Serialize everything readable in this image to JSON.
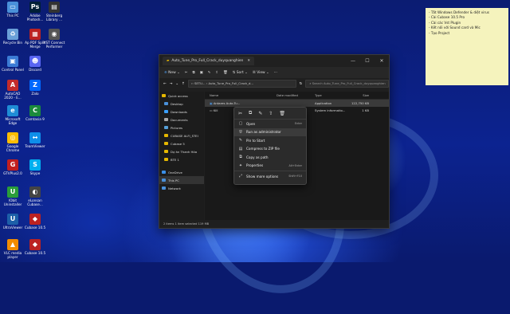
{
  "note": {
    "lines": [
      "- Tắt Windows Defender & diệt virus",
      "- Cài Cubase 10.5 Pro",
      "- Cài các Vst Plugin",
      "- Kết nối với Sound card và Mic",
      "- Tạo Project"
    ]
  },
  "desktop": {
    "icons": [
      {
        "label": "This PC",
        "color": "#4a90d9",
        "glyph": "▭"
      },
      {
        "label": "Adobe Photosh...",
        "color": "#001e36",
        "glyph": "Ps"
      },
      {
        "label": "Steinberg Library ...",
        "color": "#333",
        "glyph": "▤"
      },
      {
        "label": "Recycle Bin",
        "color": "#6aa0d8",
        "glyph": "♻"
      },
      {
        "label": "Ap PDF Split Merge",
        "color": "#b22",
        "glyph": "▦"
      },
      {
        "label": "VST Connect Performer",
        "color": "#555",
        "glyph": "◉"
      },
      {
        "label": "Control Panel",
        "color": "#3b7bd5",
        "glyph": "▣"
      },
      {
        "label": "Discord",
        "color": "#5865f2",
        "glyph": "☻"
      },
      {
        "label": "AutoCAD 2020 - E...",
        "color": "#c42b2b",
        "glyph": "A"
      },
      {
        "label": "Zalo",
        "color": "#0068ff",
        "glyph": "Z"
      },
      {
        "label": "Microsoft Edge",
        "color": "#1f8dd6",
        "glyph": "e"
      },
      {
        "label": "Camtasia 9",
        "color": "#1b8a3c",
        "glyph": "C"
      },
      {
        "label": "Google Chrome",
        "color": "#fbbc05",
        "glyph": "◎"
      },
      {
        "label": "TeamViewer",
        "color": "#0e8ee9",
        "glyph": "↔"
      },
      {
        "label": "GTVPlus2.0",
        "color": "#c21f1f",
        "glyph": "G"
      },
      {
        "label": "Skype",
        "color": "#00aff0",
        "glyph": "S"
      },
      {
        "label": "IObit Uninstaller",
        "color": "#2a9d3a",
        "glyph": "U"
      },
      {
        "label": "eLonsan Cubase...",
        "color": "#444",
        "glyph": "◐"
      },
      {
        "label": "UltraViewer",
        "color": "#1d5fa8",
        "glyph": "U"
      },
      {
        "label": "Cubase 10.5",
        "color": "#b22",
        "glyph": "◆"
      },
      {
        "label": "VLC media player",
        "color": "#f28c00",
        "glyph": "▲"
      },
      {
        "label": "Cubase 10.5",
        "color": "#b22",
        "glyph": "◆"
      }
    ]
  },
  "explorer": {
    "tab_title": "Auto_Tune_Pro_Full_Crack_duyquanghien",
    "window_controls": {
      "minimize": "—",
      "maximize": "☐",
      "close": "✕"
    },
    "toolbar": {
      "new_label": "New",
      "sort_label": "Sort",
      "view_label": "View",
      "more": "···"
    },
    "address": {
      "path": "‹‹  SETU...  ›  Auto_Tune_Pro_Full_Crack_d...",
      "search_placeholder": "Search Auto_Tune_Pro_Full_Crack_duyquanghien"
    },
    "sidebar": {
      "items": [
        {
          "label": "Quick access",
          "color": "#e6b800"
        },
        {
          "label": "Desktop",
          "color": "#4a90d9"
        },
        {
          "label": "Downloads",
          "color": "#3aa0ff"
        },
        {
          "label": "Documents",
          "color": "#aaaaaa"
        },
        {
          "label": "Pictures",
          "color": "#56a0d8"
        },
        {
          "label": "CUBASE ALFI_STEI",
          "color": "#e6b800"
        },
        {
          "label": "Cubase 5",
          "color": "#e6b800"
        },
        {
          "label": "Dự án Thanh Hóa",
          "color": "#e6b800"
        },
        {
          "label": "BTE 1",
          "color": "#e6b800"
        },
        {
          "label": "OneDrive",
          "color": "#3a8ee6"
        },
        {
          "label": "This PC",
          "color": "#4a90d9"
        },
        {
          "label": "Network",
          "color": "#4a90d9"
        }
      ]
    },
    "columns": {
      "name": "Name",
      "date": "Date modified",
      "type": "Type",
      "size": "Size"
    },
    "files": [
      {
        "name": "Antares Auto-Tu...",
        "date": "",
        "type": "Application",
        "size": "122,750 KB"
      },
      {
        "name": "Kill",
        "date": "",
        "type": "System informatio...",
        "size": "1 KB"
      }
    ],
    "status": "2 items    1 item selected  119 MB"
  },
  "context_menu": {
    "quick_icons": [
      "cut",
      "copy",
      "rename",
      "share",
      "delete"
    ],
    "items": [
      {
        "label": "Open",
        "shortcut": "Enter",
        "icon": "▢"
      },
      {
        "label": "Run as administrator",
        "shortcut": "",
        "icon": "⛨"
      },
      {
        "label": "Pin to Start",
        "shortcut": "",
        "icon": "✎"
      },
      {
        "label": "Compress to ZIP file",
        "shortcut": "",
        "icon": "▤"
      },
      {
        "label": "Copy as path",
        "shortcut": "",
        "icon": "⧉"
      },
      {
        "label": "Properties",
        "shortcut": "Alt+Enter",
        "icon": "✦"
      },
      {
        "label": "Show more options",
        "shortcut": "Shift+F10",
        "icon": "⤢"
      }
    ]
  }
}
